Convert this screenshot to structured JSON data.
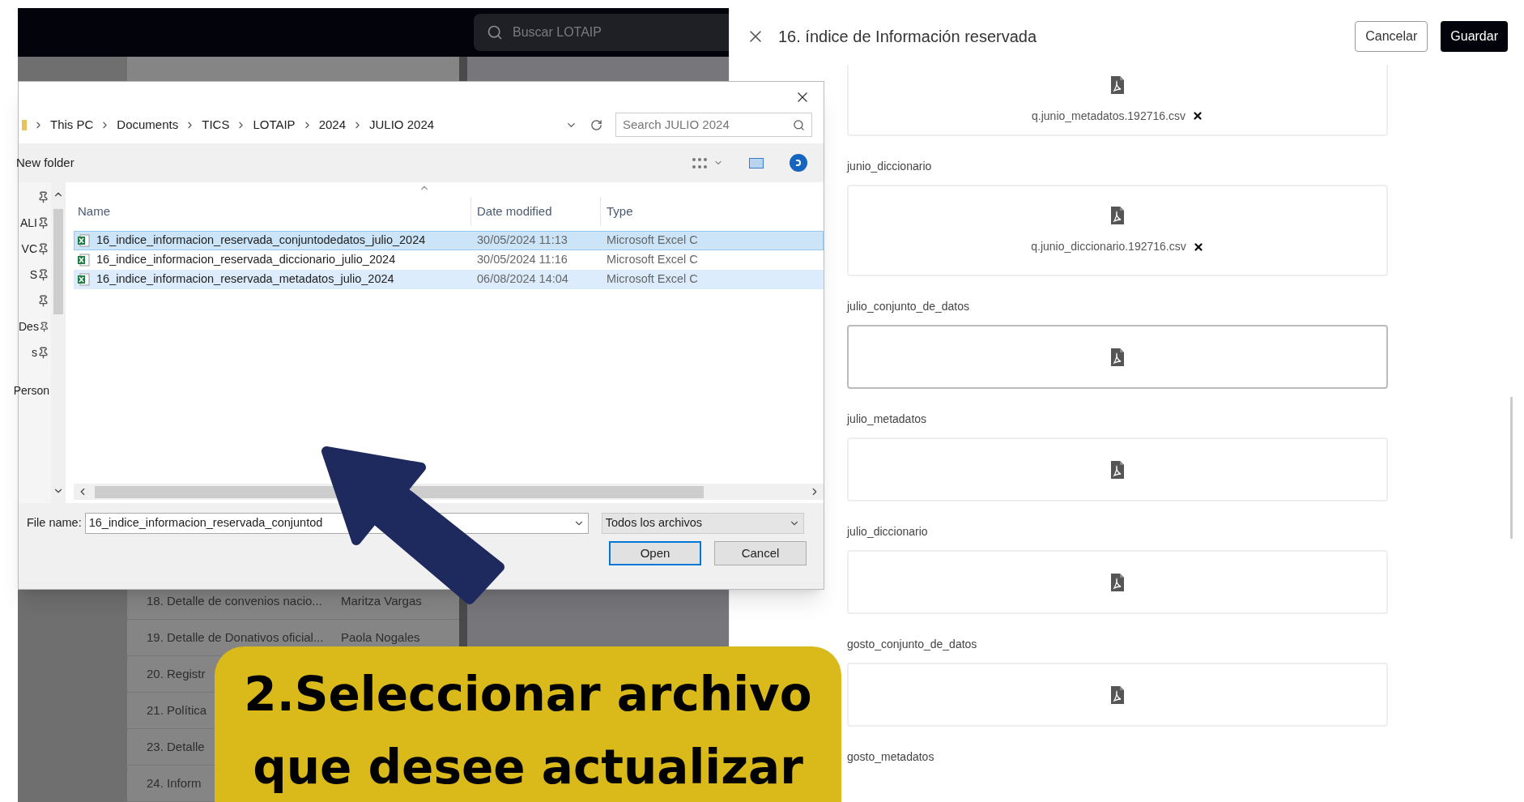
{
  "background_app": {
    "search": {
      "placeholder": "Buscar LOTAIP"
    },
    "rows": [
      {
        "title": "18. Detalle de convenios nacio...",
        "owner": "Maritza Vargas"
      },
      {
        "title": "19. Detalle de Donativos oficial...",
        "owner": "Paola Nogales"
      },
      {
        "title": "20. Registr"
      },
      {
        "title": "21. Política"
      },
      {
        "title": "23. Detalle"
      },
      {
        "title": "24. Inform"
      }
    ]
  },
  "file_dialog": {
    "breadcrumb": [
      "This PC",
      "Documents",
      "TICS",
      "LOTAIP",
      "2024",
      "JULIO 2024"
    ],
    "search": {
      "placeholder": "Search JULIO 2024"
    },
    "new_folder": "New folder",
    "sidebar": [
      {
        "pinned": true
      },
      {
        "label": "ALI",
        "pinned": true
      },
      {
        "label": "VC",
        "pinned": true
      },
      {
        "label": "S",
        "pinned": true
      },
      {
        "pinned": true
      },
      {
        "label": "Des",
        "pinned": true
      },
      {
        "label": "s",
        "pinned": true
      },
      {
        "label": "Person",
        "pinned": false
      }
    ],
    "columns": [
      "Name",
      "Date modified",
      "Type"
    ],
    "files": [
      {
        "name": "16_indice_informacion_reservada_conjuntodedatos_julio_2024",
        "date": "30/05/2024 11:13",
        "type": "Microsoft Excel C",
        "selected": true,
        "focused": true
      },
      {
        "name": "16_indice_informacion_reservada_diccionario_julio_2024",
        "date": "30/05/2024 11:16",
        "type": "Microsoft Excel C",
        "selected": false,
        "focused": false
      },
      {
        "name": "16_indice_informacion_reservada_metadatos_julio_2024",
        "date": "06/08/2024 14:04",
        "type": "Microsoft Excel C",
        "selected": true,
        "focused": false
      }
    ],
    "file_name": {
      "label": "File name:",
      "value": "16_indice_informacion_reservada_conjuntod"
    },
    "file_type": "Todos los archivos",
    "buttons": [
      "Open",
      "Cancel"
    ]
  },
  "panel": {
    "title": "16. índice de Información reservada",
    "buttons": [
      "Cancelar",
      "Guardar"
    ],
    "fields": [
      {
        "file": "q.junio_metadatos.192716.csv",
        "focused": false
      },
      {
        "label": "junio_diccionario",
        "file": "q.junio_diccionario.192716.csv",
        "focused": false
      },
      {
        "label": "julio_conjunto_de_datos",
        "focused": true
      },
      {
        "label": "julio_metadatos",
        "focused": false
      },
      {
        "label": "julio_diccionario",
        "focused": false
      },
      {
        "label": "gosto_conjunto_de_datos",
        "focused": false
      },
      {
        "label": "gosto_metadatos"
      }
    ]
  },
  "callout": {
    "lines": [
      "2.Seleccionar archivo",
      "que desee actualizar"
    ]
  }
}
